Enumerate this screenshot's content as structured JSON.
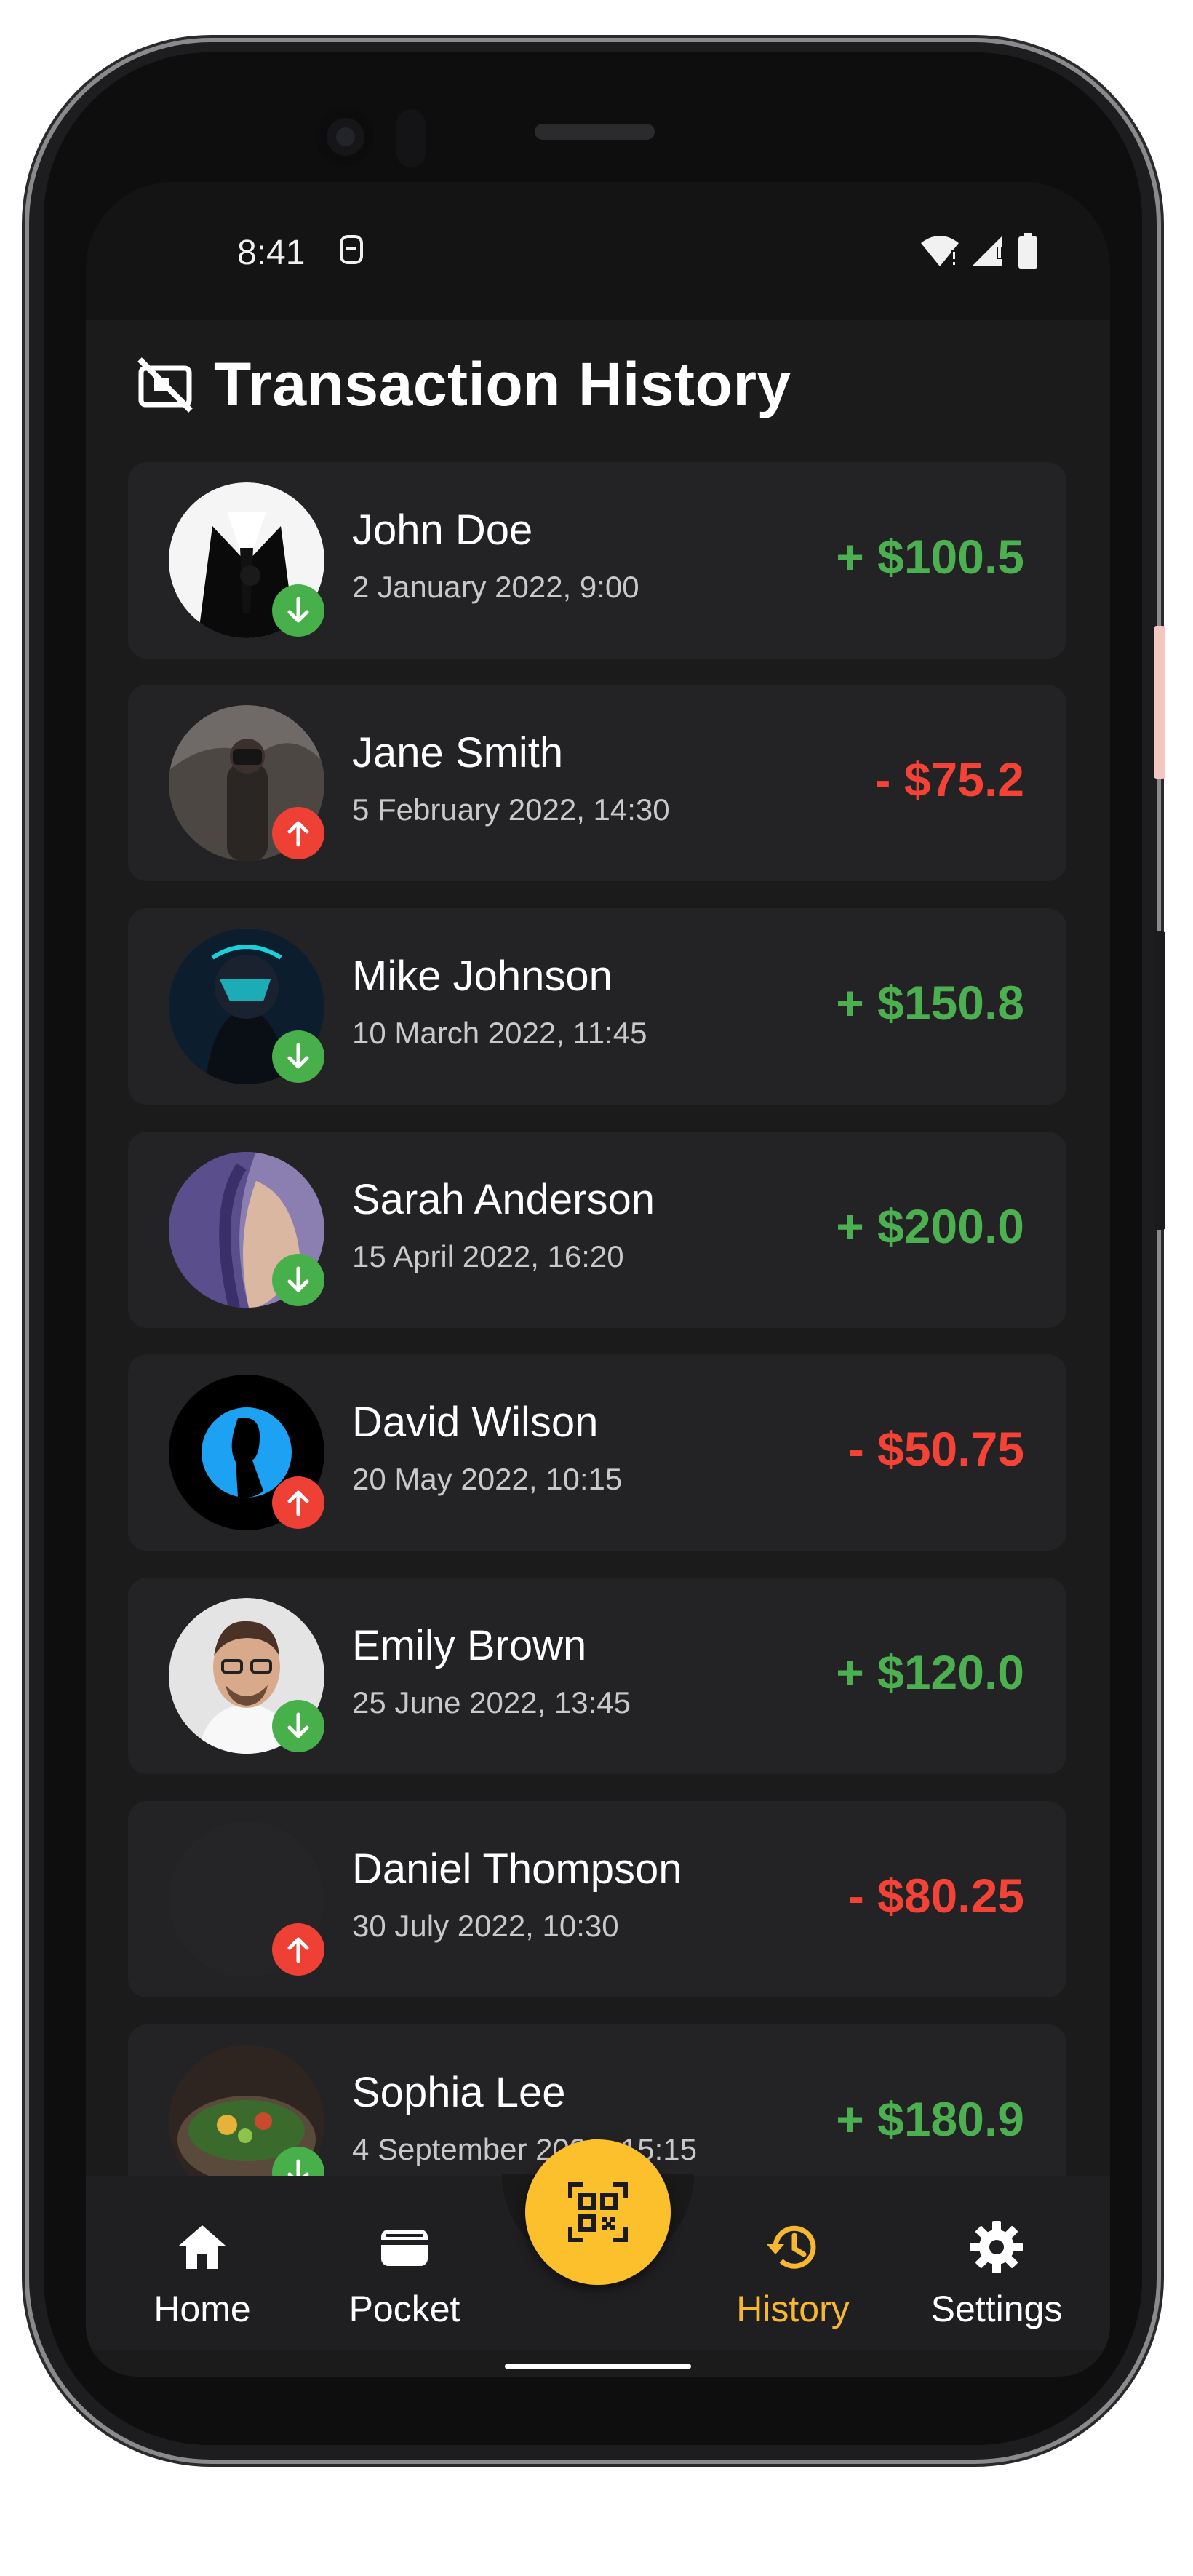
{
  "status_bar": {
    "time": "8:41"
  },
  "page_title": "Transaction History",
  "transactions": [
    {
      "name": "John Doe",
      "date": "2 January 2022, 9:00",
      "amount": "+ $100.5",
      "direction": "in"
    },
    {
      "name": "Jane Smith",
      "date": "5 February 2022, 14:30",
      "amount": "- $75.2",
      "direction": "out"
    },
    {
      "name": "Mike Johnson",
      "date": "10 March 2022, 11:45",
      "amount": "+ $150.8",
      "direction": "in"
    },
    {
      "name": "Sarah Anderson",
      "date": "15 April 2022, 16:20",
      "amount": "+ $200.0",
      "direction": "in"
    },
    {
      "name": "David Wilson",
      "date": "20 May 2022, 10:15",
      "amount": "- $50.75",
      "direction": "out"
    },
    {
      "name": "Emily Brown",
      "date": "25 June 2022, 13:45",
      "amount": "+ $120.0",
      "direction": "in"
    },
    {
      "name": "Daniel Thompson",
      "date": "30 July 2022, 10:30",
      "amount": "- $80.25",
      "direction": "out"
    },
    {
      "name": "Sophia Lee",
      "date": "4 September 2022, 15:15",
      "amount": "+ $180.9",
      "direction": "in"
    }
  ],
  "bottom_nav": {
    "items": [
      {
        "label": "Home",
        "icon": "home-icon"
      },
      {
        "label": "Pocket",
        "icon": "wallet-icon"
      },
      {
        "label": "History",
        "icon": "history-icon",
        "active": true
      },
      {
        "label": "Settings",
        "icon": "gear-icon"
      }
    ],
    "fab_icon": "qr-scan-icon"
  },
  "colors": {
    "income": "#4caf50",
    "expense": "#f44336",
    "accent": "#fcc02c",
    "background": "#1b1b1c",
    "card": "#232325"
  }
}
